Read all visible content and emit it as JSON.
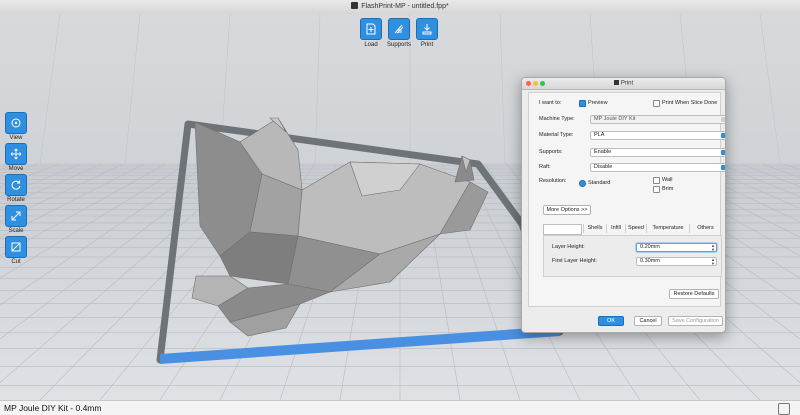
{
  "window": {
    "title": "FlashPrint-MP - untitled.fpp*"
  },
  "toolbar": {
    "load_label": "Load",
    "supports_label": "Supports",
    "print_label": "Print"
  },
  "left_toolbar": {
    "items": [
      {
        "label": "View",
        "icon": "view-icon"
      },
      {
        "label": "Move",
        "icon": "move-icon"
      },
      {
        "label": "Rotate",
        "icon": "rotate-icon"
      },
      {
        "label": "Scale",
        "icon": "scale-icon"
      },
      {
        "label": "Cut",
        "icon": "cut-icon"
      }
    ]
  },
  "status": {
    "text": "MP Joule DIY Kit - 0.4mm"
  },
  "dialog": {
    "title": "Print",
    "i_want_to_label": "I want to:",
    "preview_label": "Preview",
    "preview_checked": true,
    "print_when_done_label": "Print When Slice Done",
    "print_when_done_checked": false,
    "machine_type_label": "Machine Type:",
    "machine_type_value": "MP Joule DIY Kit",
    "material_type_label": "Material Type:",
    "material_type_value": "PLA",
    "supports_label": "Supports:",
    "supports_value": "Enable",
    "raft_label": "Raft:",
    "raft_value": "Disable",
    "resolution_label": "Resolution:",
    "resolution_standard": "Standard",
    "wall_label": "Wall",
    "brim_label": "Brim",
    "more_options_label": "More Options >>",
    "tabs": [
      "",
      "Shells",
      "Infill",
      "Speed",
      "Temperature",
      "Others"
    ],
    "layer_height_label": "Layer Height:",
    "layer_height_value": "0.20mm",
    "first_layer_height_label": "First Layer Height:",
    "first_layer_height_value": "0.30mm",
    "restore_defaults_label": "Restore Defaults",
    "ok_label": "OK",
    "cancel_label": "Cancel",
    "save_config_label": "Save Configuration"
  },
  "colors": {
    "accent": "#2f8fe0",
    "model": "#9a9a9a",
    "platform_frame": "#6e7378",
    "platform_edge": "#4a90e2"
  }
}
